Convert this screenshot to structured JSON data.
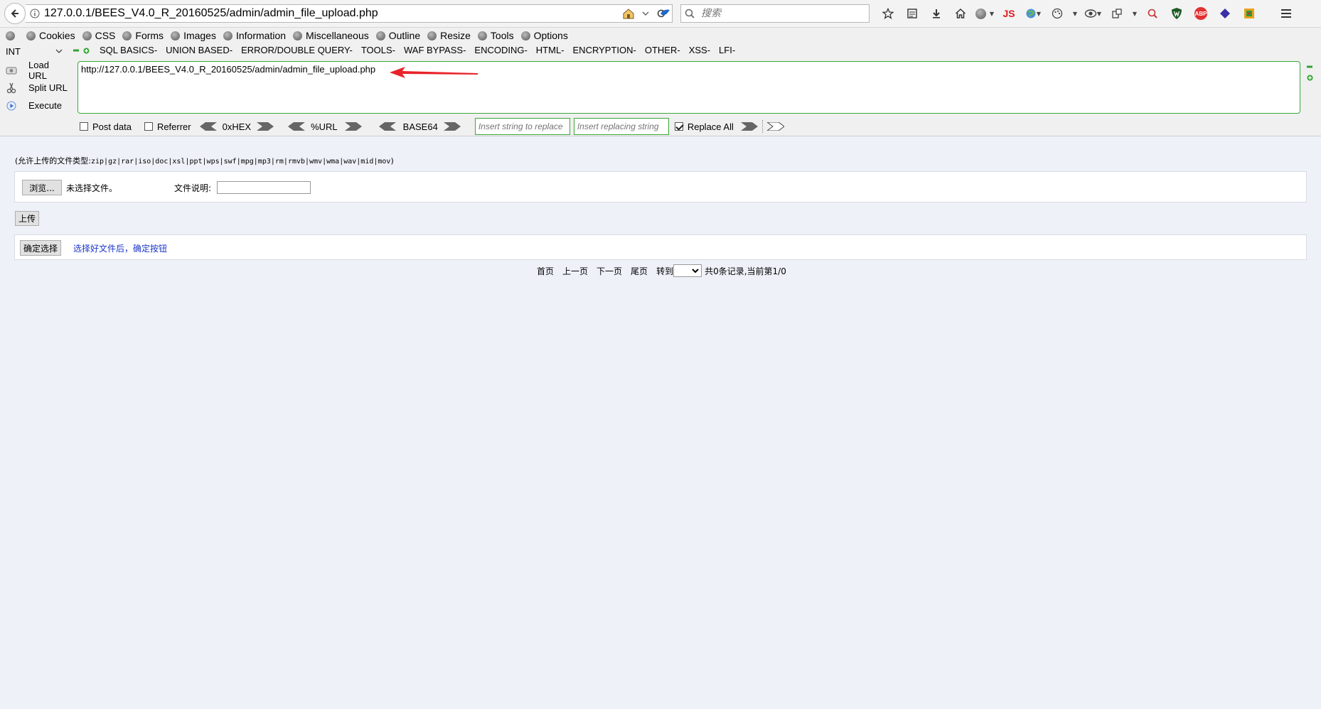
{
  "navbar": {
    "url": "127.0.0.1/BEES_V4.0_R_20160525/admin/admin_file_upload.php",
    "search_placeholder": "搜索",
    "js_badge": "JS",
    "abp_badge": "ABP"
  },
  "devbar": {
    "items": [
      "Cookies",
      "CSS",
      "Forms",
      "Images",
      "Information",
      "Miscellaneous",
      "Outline",
      "Resize",
      "Tools",
      "Options"
    ]
  },
  "hackbar": {
    "int_select": "INT",
    "menus": [
      "SQL BASICS-",
      "UNION BASED-",
      "ERROR/DOUBLE QUERY-",
      "TOOLS-",
      "WAF BYPASS-",
      "ENCODING-",
      "HTML-",
      "ENCRYPTION-",
      "OTHER-",
      "XSS-",
      "LFI-"
    ],
    "load_url": "Load URL",
    "split_url": "Split URL",
    "execute": "Execute",
    "url_value": "http://127.0.0.1/BEES_V4.0_R_20160525/admin/admin_file_upload.php",
    "post_data": "Post data",
    "referrer": "Referrer",
    "hex": "0xHEX",
    "urlenc": "%URL",
    "base64": "BASE64",
    "insert_placeholder": "Insert string to replace",
    "replacing_placeholder": "Insert replacing string",
    "replace_all": "Replace All",
    "colors": {
      "accent_green": "#3ba83a",
      "arrow_red": "#e8232a"
    }
  },
  "page": {
    "allowed_types_label": "(允许上传的文件类型:",
    "allowed_types": "zip|gz|rar|iso|doc|xsl|ppt|wps|swf|mpg|mp3|rm|rmvb|wmv|wma|wav|mid|mov",
    "allowed_types_end": ")",
    "browse_button": "浏览...",
    "no_file": "未选择文件。",
    "file_desc_label": "文件说明:",
    "upload_button": "上传",
    "confirm_button": "确定选择",
    "confirm_hint": "选择好文件后，确定按钮",
    "pager": {
      "first": "首页",
      "prev": "上一页",
      "next": "下一页",
      "last": "尾页",
      "goto": "转到",
      "summary": "共0条记录,当前第1/0"
    }
  }
}
